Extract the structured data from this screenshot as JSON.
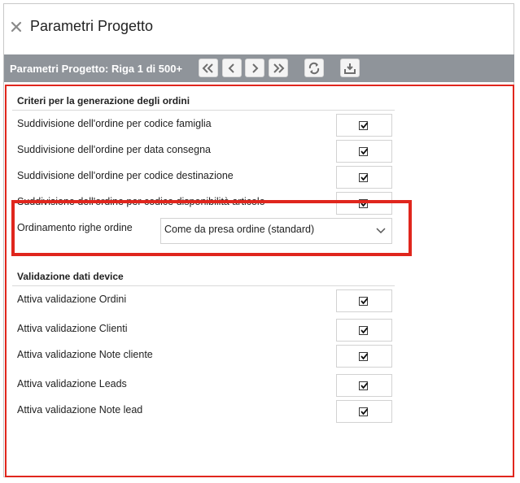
{
  "window": {
    "title": "Parametri Progetto",
    "close_icon": "close-icon"
  },
  "toolbar": {
    "record_info": "Parametri Progetto: Riga 1 di 500+",
    "buttons": [
      {
        "name": "first-page-button",
        "icon": "double-chevron-left-icon"
      },
      {
        "name": "prev-page-button",
        "icon": "chevron-left-icon"
      },
      {
        "name": "next-page-button",
        "icon": "chevron-right-icon"
      },
      {
        "name": "last-page-button",
        "icon": "double-chevron-right-icon"
      },
      {
        "name": "refresh-button",
        "icon": "refresh-icon"
      },
      {
        "name": "save-button",
        "icon": "download-tray-icon"
      }
    ]
  },
  "section1": {
    "title": "Criteri per la generazione degli ordini",
    "rows": [
      {
        "label": "Suddivisione dell'ordine per codice famiglia",
        "checked": true
      },
      {
        "label": "Suddivisione dell'ordine per data consegna",
        "checked": true
      },
      {
        "label": "Suddivisione dell'ordine per codice destinazione",
        "checked": true
      },
      {
        "label": "Suddivisione dell'ordine per codice disponibilità articolo",
        "checked": true
      }
    ],
    "sort": {
      "label": "Ordinamento righe ordine",
      "value": "Come da presa ordine (standard)"
    }
  },
  "section2": {
    "title": "Validazione dati device",
    "rows": [
      {
        "label": "Attiva validazione Ordini",
        "checked": true
      },
      {
        "label": "Attiva validazione Clienti",
        "checked": true
      },
      {
        "label": "Attiva validazione Note cliente",
        "checked": true
      },
      {
        "label": "Attiva validazione Leads",
        "checked": true
      },
      {
        "label": "Attiva validazione Note lead",
        "checked": true
      }
    ]
  },
  "colors": {
    "accent_red": "#e0261d",
    "toolbar_gray": "#8f949a"
  }
}
